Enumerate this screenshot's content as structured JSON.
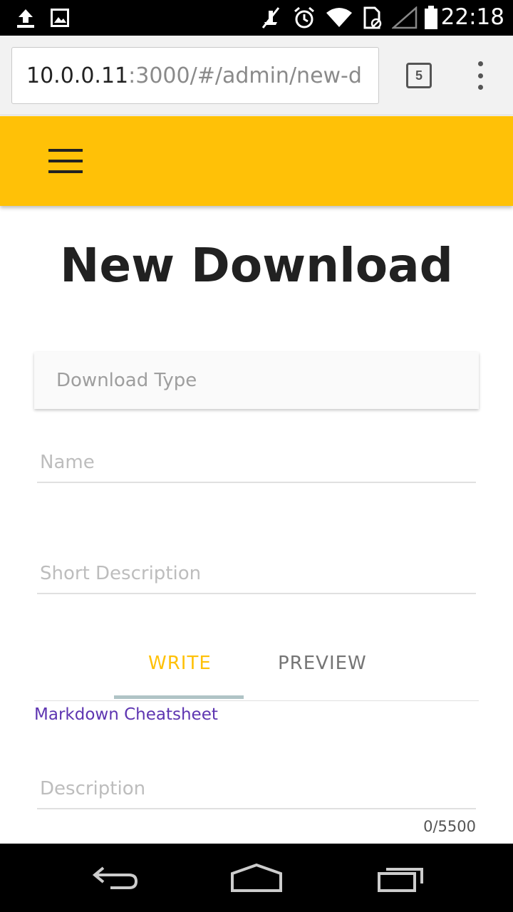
{
  "status_bar": {
    "time": "22:18",
    "icons": [
      "upload-icon",
      "image-icon",
      "mute-icon",
      "alarm-icon",
      "wifi-icon",
      "sim-icon",
      "signal-icon",
      "battery-icon"
    ]
  },
  "browser": {
    "url_host": "10.0.0.11",
    "url_path": ":3000/#/admin/new-d",
    "tab_count": "5"
  },
  "page": {
    "title": "New Download"
  },
  "form": {
    "download_type_placeholder": "Download Type",
    "name_placeholder": "Name",
    "short_description_placeholder": "Short Description",
    "tabs": [
      {
        "label": "WRITE",
        "active": true
      },
      {
        "label": "PREVIEW",
        "active": false
      }
    ],
    "cheatsheet_link": "Markdown Cheatsheet",
    "description_placeholder": "Description",
    "char_count": "0/5500"
  },
  "colors": {
    "accent": "#ffc107",
    "link": "#5e35b1",
    "tab_indicator": "#b0c4c6"
  }
}
